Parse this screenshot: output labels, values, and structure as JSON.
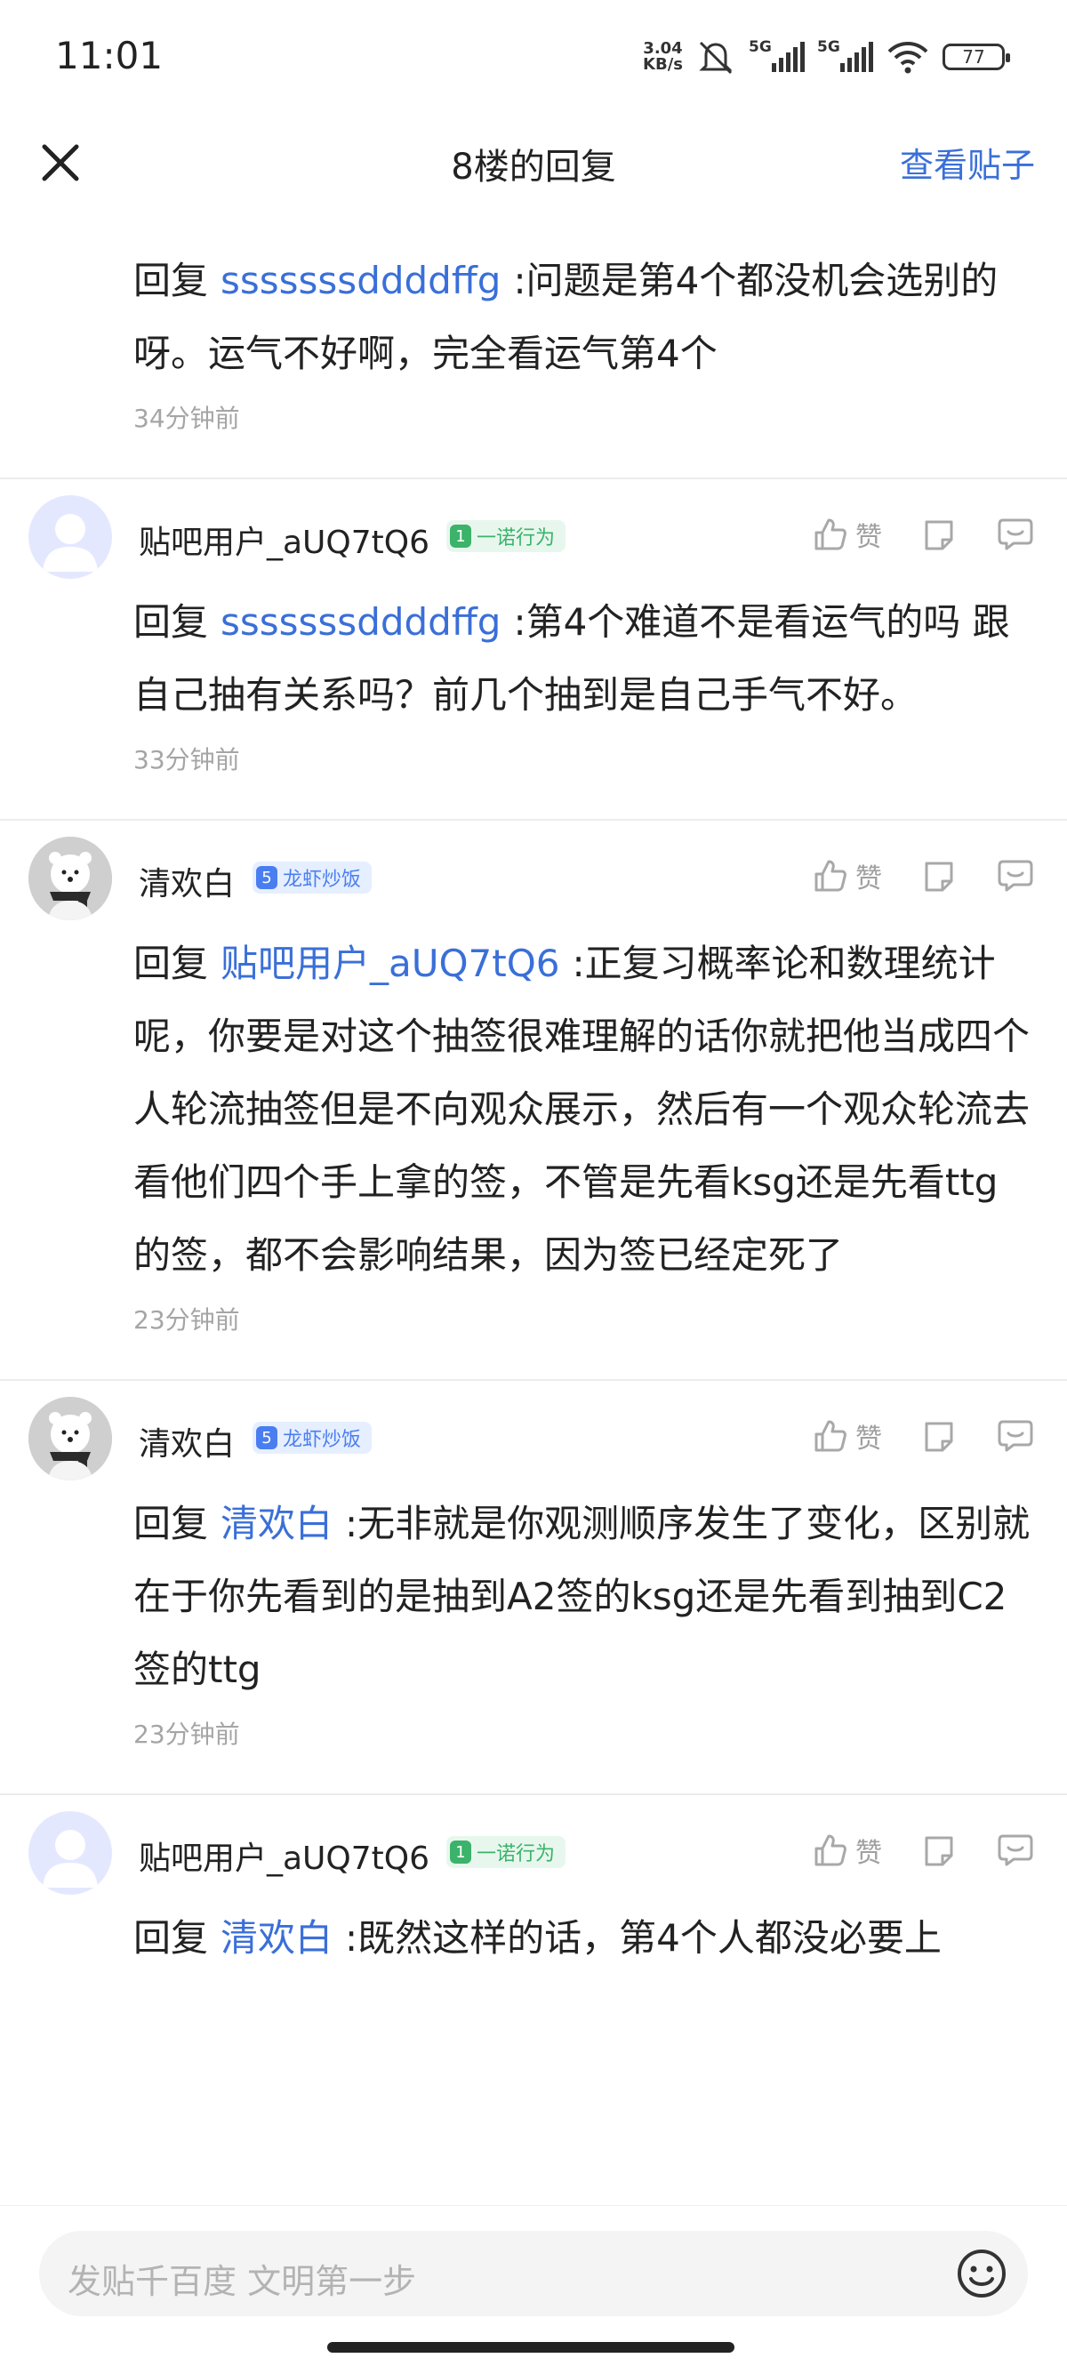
{
  "status": {
    "time": "11:01",
    "net_speed_value": "3.04",
    "net_speed_unit": "KB/s",
    "sim1_label": "5G",
    "sim2_label": "5G",
    "battery": "77"
  },
  "nav": {
    "title": "8楼的回复",
    "view_post": "查看贴子"
  },
  "replies": [
    {
      "prefix": "回复",
      "mention": "sssssssddddffg",
      "text": ":问题是第4个都没机会选别的呀。运气不好啊，完全看运气第4个",
      "time": "34分钟前"
    },
    {
      "username": "贴吧用户_aUQ7tQ6",
      "badge_level": "1",
      "badge_text": "一诺行为",
      "like": "赞",
      "prefix": "回复",
      "mention": "sssssssddddffg",
      "text": ":第4个难道不是看运气的吗 跟自己抽有关系吗？前几个抽到是自己手气不好。",
      "time": "33分钟前"
    },
    {
      "username": "清欢白",
      "badge_level": "5",
      "badge_text": "龙虾炒饭",
      "like": "赞",
      "prefix": "回复",
      "mention": "贴吧用户_aUQ7tQ6",
      "text": ":正复习概率论和数理统计呢，你要是对这个抽签很难理解的话你就把他当成四个人轮流抽签但是不向观众展示，然后有一个观众轮流去看他们四个手上拿的签，不管是先看ksg还是先看ttg的签，都不会影响结果，因为签已经定死了",
      "time": "23分钟前"
    },
    {
      "username": "清欢白",
      "badge_level": "5",
      "badge_text": "龙虾炒饭",
      "like": "赞",
      "prefix": "回复",
      "mention": "清欢白",
      "text": ":无非就是你观测顺序发生了变化，区别就在于你先看到的是抽到A2签的ksg还是先看到抽到C2签的ttg",
      "time": "23分钟前"
    },
    {
      "username": "贴吧用户_aUQ7tQ6",
      "badge_level": "1",
      "badge_text": "一诺行为",
      "like": "赞",
      "prefix": "回复",
      "mention": "清欢白",
      "text": ":既然这样的话，第4个人都没必要上"
    }
  ],
  "composer": {
    "placeholder": "发贴千百度 文明第一步"
  },
  "icons": {
    "close": "close-icon",
    "like": "thumbs-up-icon",
    "share": "share-icon",
    "comment": "comment-icon",
    "emoji": "emoji-icon"
  },
  "colors": {
    "link": "#3a6fd8",
    "badge_green": "#3bb36a",
    "badge_blue": "#4a7ef0"
  }
}
